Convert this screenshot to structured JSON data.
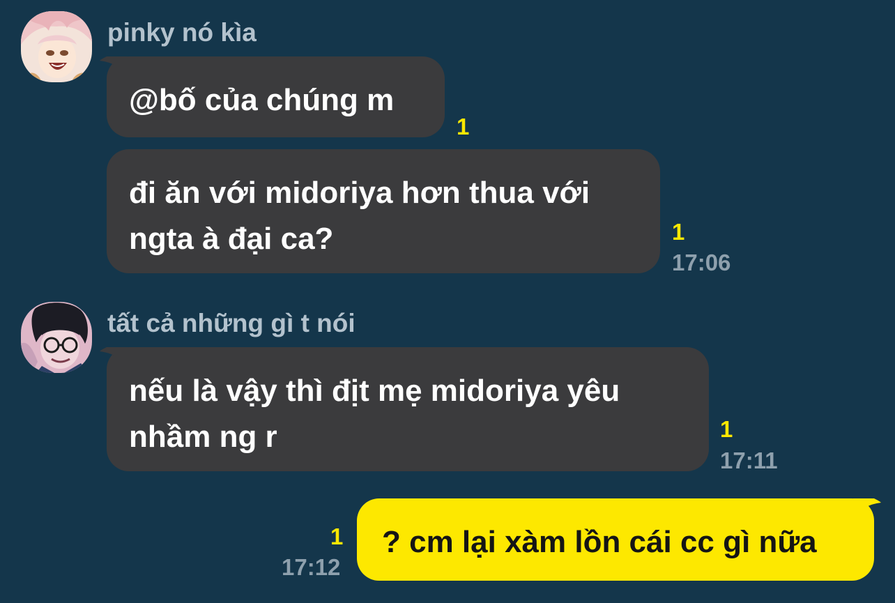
{
  "chat": {
    "groups": [
      {
        "sender": "pinky nó kìa",
        "avatar_icon": "anime-avatar-pink-hair",
        "messages": [
          {
            "text": "@bố của chúng m",
            "unread": "1",
            "time": ""
          },
          {
            "lines": [
              "đi ăn với midoriya hơn thua với",
              "ngta à đại ca?"
            ],
            "unread": "1",
            "time": "17:06"
          }
        ]
      },
      {
        "sender": "tất cả những gì t nói",
        "avatar_icon": "anime-avatar-glasses",
        "messages": [
          {
            "lines": [
              "nếu là vậy thì địt mẹ midoriya yêu",
              "nhầm ng r"
            ],
            "unread": "1",
            "time": "17:11"
          }
        ]
      }
    ],
    "outgoing": [
      {
        "text": "? cm lại xàm lồn cái cc gì nữa",
        "unread": "1",
        "time": "17:12"
      }
    ]
  },
  "colors": {
    "background": "#14364b",
    "incoming_bubble": "#3b3b3d",
    "outgoing_bubble": "#fde800",
    "unread_count": "#fde800",
    "timestamp": "#8ea0ad",
    "sender_name": "#b3c2cd"
  }
}
